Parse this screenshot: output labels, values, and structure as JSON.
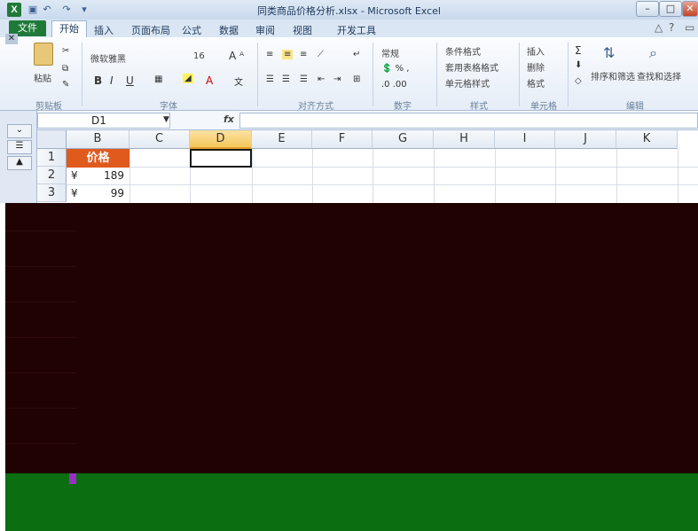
{
  "window": {
    "title": "同类商品价格分析.xlsx - Microsoft Excel",
    "app_icon_letter": "X",
    "minimize_label": "–",
    "maximize_label": "□",
    "close_label": "✕"
  },
  "ribbon": {
    "tabs": [
      "文件",
      "开始",
      "插入",
      "页面布局",
      "公式",
      "数据",
      "审阅",
      "视图",
      "开发工具"
    ],
    "font_name": "微软雅黑",
    "font_size": "16",
    "number_format": "常规",
    "styles": [
      "条件格式",
      "套用表格格式",
      "单元格样式"
    ],
    "cells": [
      "插入",
      "删除",
      "格式"
    ],
    "edit": [
      "排序和筛选",
      "查找和选择"
    ],
    "groups": [
      "剪贴板",
      "字体",
      "对齐方式",
      "数字",
      "样式",
      "单元格",
      "编辑"
    ],
    "paste_label": "粘贴"
  },
  "formula_bar": {
    "name_box": "D1",
    "fx": "fx",
    "value": ""
  },
  "sheet": {
    "columns": [
      "B",
      "C",
      "D",
      "E",
      "F",
      "G",
      "H",
      "I",
      "J",
      "K"
    ],
    "selected_column": "D",
    "rows": [
      "1",
      "2",
      "3"
    ],
    "header_cell": "价格",
    "currency_symbol": "¥",
    "values": [
      "189",
      "99"
    ],
    "active_cell": "D1",
    "colors": {
      "header_fill": "#e05a1e",
      "dark_region": "#210202",
      "bottom_region": "#0b6e10"
    }
  }
}
